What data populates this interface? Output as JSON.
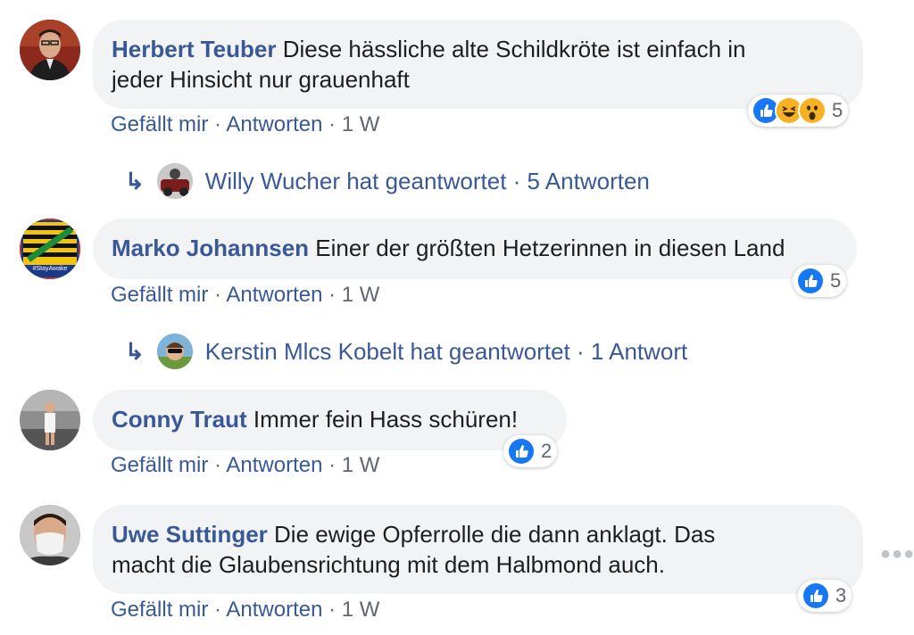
{
  "comments": [
    {
      "author": "Herbert Teuber",
      "text": "Diese hässliche alte Schildkröte ist einfach in",
      "text2": "jeder Hinsicht nur grauenhaft",
      "reactions": {
        "types": [
          "like-icon",
          "laugh-icon",
          "wow-icon"
        ],
        "count": "5"
      },
      "actions": {
        "like": "Gefällt mir",
        "reply": "Antworten",
        "age": "1 W"
      },
      "reply_summary": "Willy Wucher hat geantwortet · 5 Antworten"
    },
    {
      "author": "Marko Johannsen",
      "text": "Einer der größten Hetzerinnen in diesen Land",
      "reactions": {
        "types": [
          "like-icon"
        ],
        "count": "5"
      },
      "actions": {
        "like": "Gefällt mir",
        "reply": "Antworten",
        "age": "1 W"
      },
      "avatar_text": "#StayAwake",
      "reply_summary": "Kerstin Mlcs Kobelt hat geantwortet · 1 Antwort"
    },
    {
      "author": "Conny Traut",
      "text": "Immer fein Hass schüren!",
      "reactions": {
        "types": [
          "like-icon"
        ],
        "count": "2"
      },
      "actions": {
        "like": "Gefällt mir",
        "reply": "Antworten",
        "age": "1 W"
      }
    },
    {
      "author": "Uwe Suttinger",
      "text": "Die ewige Opferrolle die dann anklagt. Das",
      "text2": "macht die Glaubensrichtung mit dem Halbmond auch.",
      "reactions": {
        "types": [
          "like-icon"
        ],
        "count": "3"
      },
      "actions": {
        "like": "Gefällt mir",
        "reply": "Antworten",
        "age": "1 W"
      }
    }
  ],
  "separator": "·",
  "reply_arrow": "↳",
  "more_icon": "ellipsis-icon",
  "colors": {
    "link": "#385898",
    "bubble": "#f2f3f5",
    "like": "#1877f2",
    "muted": "#606770"
  }
}
